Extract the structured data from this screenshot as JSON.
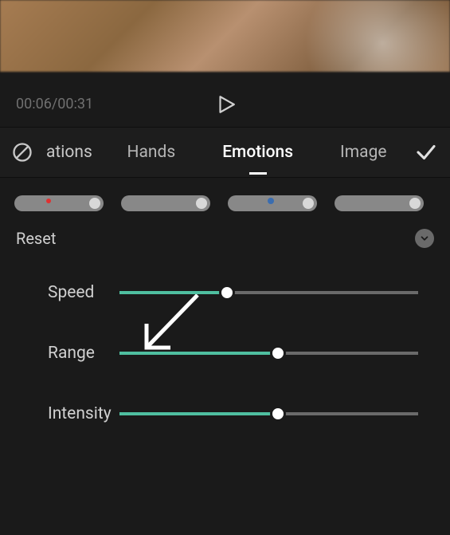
{
  "preview": {},
  "playback": {
    "current_time": "00:06",
    "total_time": "00:31",
    "timecode_display": "00:06/00:31"
  },
  "tabs": {
    "cancel_icon": "cancel",
    "items": [
      {
        "label": "ations",
        "partial": true,
        "active": false
      },
      {
        "label": "Hands",
        "active": false
      },
      {
        "label": "Emotions",
        "active": true
      },
      {
        "label": "Image",
        "active": false
      }
    ],
    "confirm_icon": "checkmark"
  },
  "presets": {
    "count": 4
  },
  "section": {
    "reset_label": "Reset",
    "collapsed": false
  },
  "sliders": [
    {
      "label": "Speed",
      "value": 36,
      "min": 0,
      "max": 100,
      "accent": "#4fbfa0"
    },
    {
      "label": "Range",
      "value": 53,
      "min": 0,
      "max": 100,
      "accent": "#4fbfa0"
    },
    {
      "label": "Intensity",
      "value": 53,
      "min": 0,
      "max": 100,
      "accent": "#4fbfa0"
    }
  ]
}
